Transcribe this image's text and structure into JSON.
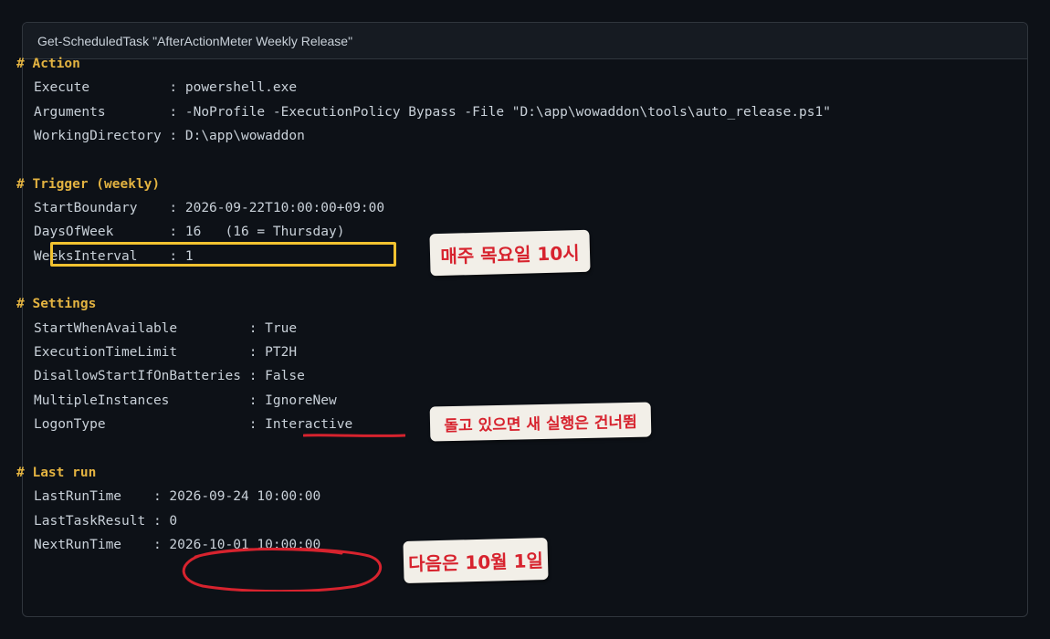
{
  "header": {
    "title": "Get-ScheduledTask \"AfterActionMeter Weekly Release\""
  },
  "code_lines": [
    {
      "kind": "comment",
      "text": "# Action"
    },
    {
      "kind": "prop",
      "text": "Execute          : powershell.exe"
    },
    {
      "kind": "prop",
      "text": "Arguments        : -NoProfile -ExecutionPolicy Bypass -File \"D:\\app\\wowaddon\\tools\\auto_release.ps1\""
    },
    {
      "kind": "prop",
      "text": "WorkingDirectory : D:\\app\\wowaddon"
    },
    {
      "kind": "blank",
      "text": ""
    },
    {
      "kind": "comment",
      "text": "# Trigger (weekly)"
    },
    {
      "kind": "prop",
      "text": "StartBoundary    : 2026-09-22T10:00:00+09:00"
    },
    {
      "kind": "prop",
      "text": "DaysOfWeek       : 16   (16 = Thursday)"
    },
    {
      "kind": "prop",
      "text": "WeeksInterval    : 1"
    },
    {
      "kind": "blank",
      "text": ""
    },
    {
      "kind": "comment",
      "text": "# Settings"
    },
    {
      "kind": "prop",
      "text": "StartWhenAvailable         : True"
    },
    {
      "kind": "prop",
      "text": "ExecutionTimeLimit         : PT2H"
    },
    {
      "kind": "prop",
      "text": "DisallowStartIfOnBatteries : False"
    },
    {
      "kind": "prop",
      "text": "MultipleInstances          : IgnoreNew"
    },
    {
      "kind": "prop",
      "text": "LogonType                  : Interactive"
    },
    {
      "kind": "blank",
      "text": ""
    },
    {
      "kind": "comment",
      "text": "# Last run"
    },
    {
      "kind": "prop",
      "text": "LastRunTime    : 2026-09-24 10:00:00"
    },
    {
      "kind": "prop",
      "text": "LastTaskResult : 0"
    },
    {
      "kind": "prop",
      "text": "NextRunTime    : 2026-10-01 10:00:00"
    }
  ],
  "annotations": {
    "note_days": "매주 목요일 10시",
    "note_instances": "돌고 있으면 새 실행은 건너뜀",
    "note_next": "다음은 10월 1일"
  },
  "colors": {
    "background": "#0d1117",
    "header_bg": "#161b22",
    "text": "#c9d1d9",
    "comment": "#e3b341",
    "highlight_box": "#f2c230",
    "annotation_red": "#d7232e",
    "note_bg": "#f2efe8"
  }
}
